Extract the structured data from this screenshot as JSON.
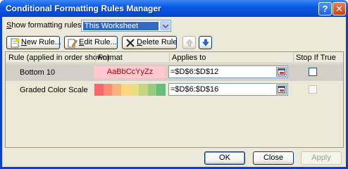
{
  "window": {
    "title": "Conditional Formatting Rules Manager",
    "help_glyph": "?",
    "close_glyph": "✕"
  },
  "show_rules": {
    "label_prefix": "S",
    "label_rest": "how formatting rules for:",
    "selected_value": "This Worksheet"
  },
  "toolbar": {
    "new_rule": {
      "accel": "N",
      "rest": "ew Rule..."
    },
    "edit_rule": {
      "accel": "E",
      "rest": "dit Rule..."
    },
    "delete_rule": {
      "accel": "D",
      "rest": "elete Rule"
    }
  },
  "table": {
    "headers": {
      "rule": "Rule (applied in order shown)",
      "format": "Format",
      "applies_to": "Applies to",
      "stop_if_true": "Stop If True"
    },
    "rows": [
      {
        "name": "Bottom 10",
        "format_preview": "AaBbCcYyZz",
        "applies_to": "=$D$6:$D$12",
        "stop_if_true": false,
        "selected": true
      },
      {
        "name": "Graded Color Scale",
        "format_preview": "",
        "applies_to": "=$D$6:$D$16",
        "stop_if_true": false,
        "selected": false
      }
    ]
  },
  "color_scale_colors": [
    "#f8696b",
    "#f98e72",
    "#fbb37a",
    "#fed880",
    "#e6e082",
    "#c2d680",
    "#9bcb7d",
    "#63be7b"
  ],
  "footer": {
    "ok": "OK",
    "close": "Close",
    "apply": "Apply"
  }
}
